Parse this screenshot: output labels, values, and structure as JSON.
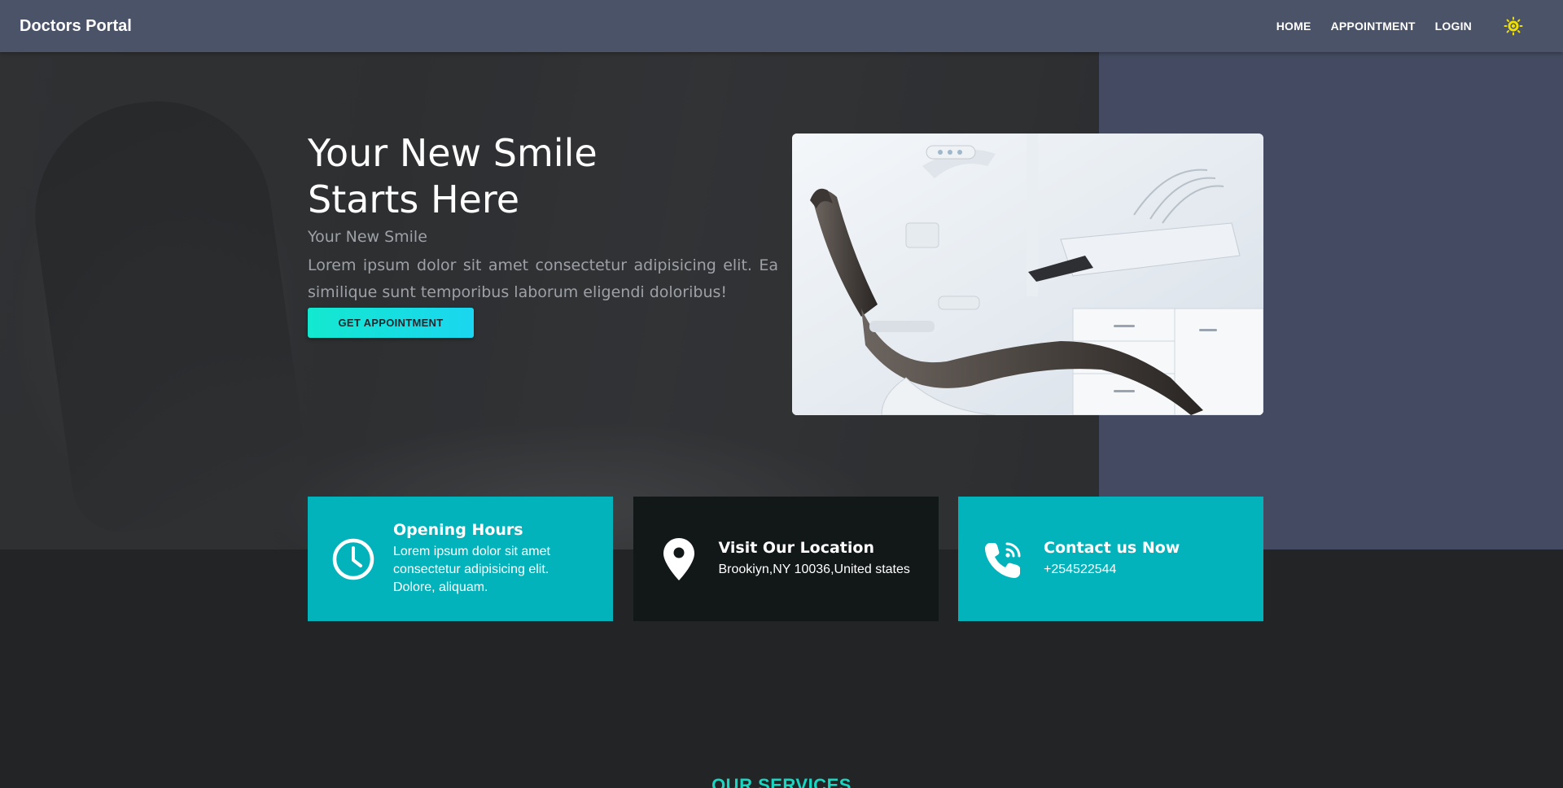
{
  "navbar": {
    "brand": "Doctors Portal",
    "links": [
      "HOME",
      "APPOINTMENT",
      "LOGIN"
    ],
    "theme_icon": "sun-icon",
    "theme_icon_color": "#f0e000"
  },
  "hero": {
    "title": "Your New Smile Starts Here",
    "subtitle": "Your New Smile",
    "text": "Lorem ipsum dolor sit amet consectetur adipisicing elit. Ea similique sunt temporibus laborum eligendi doloribus!",
    "cta_label": "GET APPOINTMENT",
    "image": "dental-chair-photo"
  },
  "cards": [
    {
      "title": "Opening Hours",
      "text": "Lorem ipsum dolor sit amet consectetur adipisicing elit. Dolore, aliquam.",
      "icon": "clock-icon",
      "color": "#02b3bb"
    },
    {
      "title": "Visit Our Location",
      "text": "Brookiyn,NY 10036,United states",
      "icon": "location-pin-icon",
      "color": "#121718"
    },
    {
      "title": "Contact us Now",
      "text": "+254522544",
      "icon": "phone-icon",
      "color": "#02b3bb"
    }
  ],
  "services": {
    "heading": "OUR SERVICES"
  },
  "colors": {
    "navbar": "#4b5369",
    "accent": "#13e8cf",
    "page_bg": "#232425"
  }
}
